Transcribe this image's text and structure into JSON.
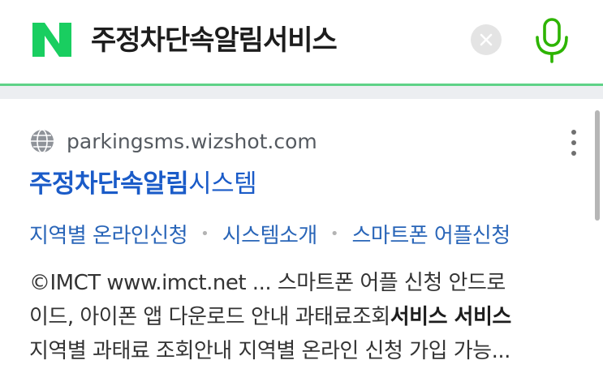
{
  "search": {
    "query": "주정차단속알림서비스",
    "brand_color": "#19ce60",
    "mic_color": "#2db400"
  },
  "result": {
    "source_url": "parkingsms.wizshot.com",
    "title_highlight": "주정차단속알림",
    "title_rest": "시스템",
    "sitelinks": [
      "지역별 온라인신청",
      "시스템소개",
      "스마트폰 어플신청"
    ],
    "separator": "•",
    "snippet": {
      "line1": "©IMCT www.imct.net ... 스마트폰 어플 신청 안드로",
      "line2_a": "이드, 아이폰 앱 다운로드 안내 과태료조회",
      "line2_b": "서비스 서비스",
      "line3": "지역별 과태료 조회안내 지역별 온라인 신청 가입 가능..."
    }
  }
}
